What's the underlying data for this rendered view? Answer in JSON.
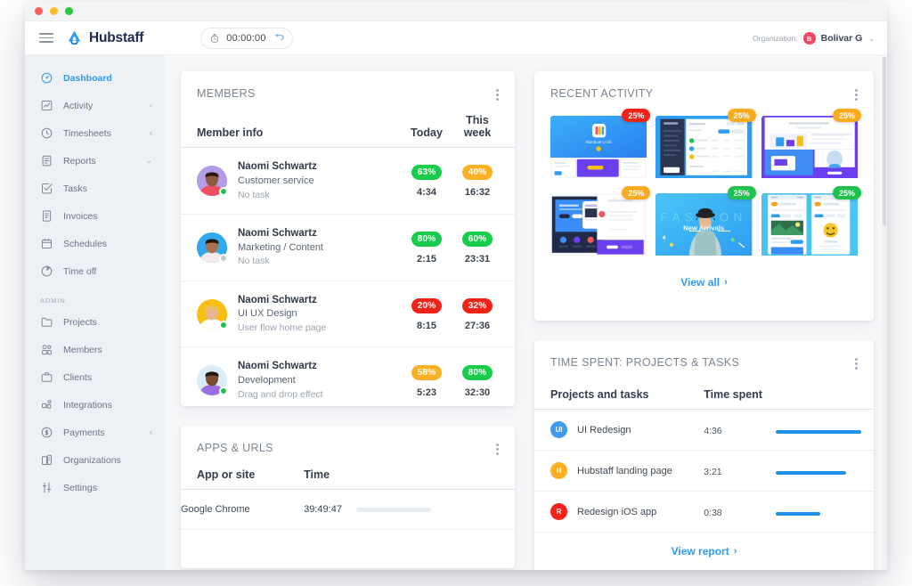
{
  "window": {
    "dots": [
      "close",
      "minimize",
      "maximize"
    ]
  },
  "topbar": {
    "menu_icon": "hamburger-icon",
    "brand": "Hubstaff",
    "brand_icon": "hubstaff-logo-icon",
    "timer": {
      "clock_icon": "stopwatch-icon",
      "value": "00:00:00",
      "play_icon": "start-timer-icon"
    },
    "organization": {
      "label": "Organization:",
      "avatar_initial": "B",
      "avatar_color": "#f2455e",
      "name": "Bolivar G",
      "caret": "⌄"
    }
  },
  "sidebar": {
    "items": [
      {
        "label": "Dashboard",
        "icon": "dashboard-icon",
        "active": true,
        "caret": ""
      },
      {
        "label": "Activity",
        "icon": "activity-chart-icon",
        "active": false,
        "caret": "‹"
      },
      {
        "label": "Timesheets",
        "icon": "clock-icon",
        "active": false,
        "caret": "‹"
      },
      {
        "label": "Reports",
        "icon": "report-doc-icon",
        "active": false,
        "caret": "⌄"
      },
      {
        "label": "Tasks",
        "icon": "checklist-icon",
        "active": false,
        "caret": ""
      },
      {
        "label": "Invoices",
        "icon": "invoice-icon",
        "active": false,
        "caret": ""
      },
      {
        "label": "Schedules",
        "icon": "calendar-icon",
        "active": false,
        "caret": ""
      },
      {
        "label": "Time off",
        "icon": "pie-clock-icon",
        "active": false,
        "caret": ""
      }
    ],
    "group_label": "ADMIN",
    "admin_items": [
      {
        "label": "Projects",
        "icon": "folder-icon",
        "active": false,
        "caret": ""
      },
      {
        "label": "Members",
        "icon": "members-icon",
        "active": false,
        "caret": ""
      },
      {
        "label": "Clients",
        "icon": "briefcase-icon",
        "active": false,
        "caret": ""
      },
      {
        "label": "Integrations",
        "icon": "integrations-icon",
        "active": false,
        "caret": ""
      },
      {
        "label": "Payments",
        "icon": "payments-coin-icon",
        "active": false,
        "caret": "‹"
      },
      {
        "label": "Organizations",
        "icon": "organizations-icon",
        "active": false,
        "caret": ""
      },
      {
        "label": "Settings",
        "icon": "sliders-icon",
        "active": false,
        "caret": ""
      }
    ]
  },
  "members_card": {
    "title": "MEMBERS",
    "menu_icon": "kebab-menu-icon",
    "columns": [
      "Member info",
      "Today",
      "This week"
    ],
    "rows": [
      {
        "name": "Naomi Schwartz",
        "role": "Customer service",
        "task": "No task",
        "avatar_bg": "#b39ce8",
        "status": "online",
        "today_pct": "63%",
        "today_color": "green",
        "today_time": "4:34",
        "week_pct": "40%",
        "week_color": "orange",
        "week_time": "16:32"
      },
      {
        "name": "Naomi Schwartz",
        "role": "Marketing / Content",
        "task": "No task",
        "avatar_bg": "#33a8ee",
        "status": "offline",
        "today_pct": "80%",
        "today_color": "green",
        "today_time": "2:15",
        "week_pct": "60%",
        "week_color": "green",
        "week_time": "23:31"
      },
      {
        "name": "Naomi Schwartz",
        "role": "UI UX Design",
        "task": "User flow home page",
        "avatar_bg": "#f7bf12",
        "status": "online",
        "today_pct": "20%",
        "today_color": "red",
        "today_time": "8:15",
        "week_pct": "32%",
        "week_color": "red",
        "week_time": "27:36"
      },
      {
        "name": "Naomi Schwartz",
        "role": "Development",
        "task": "Drag and drop effect",
        "avatar_bg": "#d8ecf9",
        "status": "online",
        "today_pct": "58%",
        "today_color": "orange",
        "today_time": "5:23",
        "week_pct": "80%",
        "week_color": "green",
        "week_time": "32:30"
      }
    ]
  },
  "apps_card": {
    "title": "APPS & URLS",
    "menu_icon": "kebab-menu-icon",
    "columns": [
      "App or site",
      "Time"
    ],
    "rows": [
      {
        "name": "Google Chrome",
        "time": "39:49:47",
        "fill_pct": 78
      }
    ]
  },
  "activity_card": {
    "title": "RECENT ACTIVITY",
    "menu_icon": "kebab-menu-icon",
    "thumbnails": [
      {
        "badge": "25%",
        "badge_color": "red",
        "caption": "Rainbow UI kit",
        "kind": "rainbow"
      },
      {
        "badge": "25%",
        "badge_color": "orange",
        "caption": "",
        "kind": "dashboard"
      },
      {
        "badge": "25%",
        "badge_color": "orange",
        "caption": "",
        "kind": "landing"
      },
      {
        "badge": "25%",
        "badge_color": "orange",
        "caption": "",
        "kind": "webapp"
      },
      {
        "badge": "25%",
        "badge_color": "green",
        "caption": "New Arrivals",
        "kind": "fashion"
      },
      {
        "badge": "25%",
        "badge_color": "green",
        "caption": "",
        "kind": "mobile"
      }
    ],
    "view_all": "View all",
    "view_all_chevron": "›"
  },
  "time_spent_card": {
    "title": "TIME SPENT: PROJECTS & TASKS",
    "menu_icon": "kebab-menu-icon",
    "columns": [
      "Projects and tasks",
      "Time spent"
    ],
    "rows": [
      {
        "initial": "UI",
        "color": "#3e9bf3",
        "name": "UI Redesign",
        "time": "4:36",
        "fill_pct": 100
      },
      {
        "initial": "H",
        "color": "#fbb024",
        "name": "Hubstaff landing page",
        "time": "3:21",
        "fill_pct": 82
      },
      {
        "initial": "R",
        "color": "#f42318",
        "name": "Redesign iOS app",
        "time": "0:38",
        "fill_pct": 52
      }
    ],
    "view_report": "View report",
    "view_report_chevron": "›"
  },
  "chart_data": {
    "type": "bar",
    "title": "TIME SPENT: PROJECTS & TASKS",
    "categories": [
      "UI Redesign",
      "Hubstaff landing page",
      "Redesign iOS app"
    ],
    "values": [
      4.6,
      3.35,
      0.633
    ],
    "value_labels": [
      "4:36",
      "3:21",
      "0:38"
    ],
    "xlabel": "Time spent",
    "ylabel": "Projects and tasks",
    "grid": false,
    "legend": false
  }
}
